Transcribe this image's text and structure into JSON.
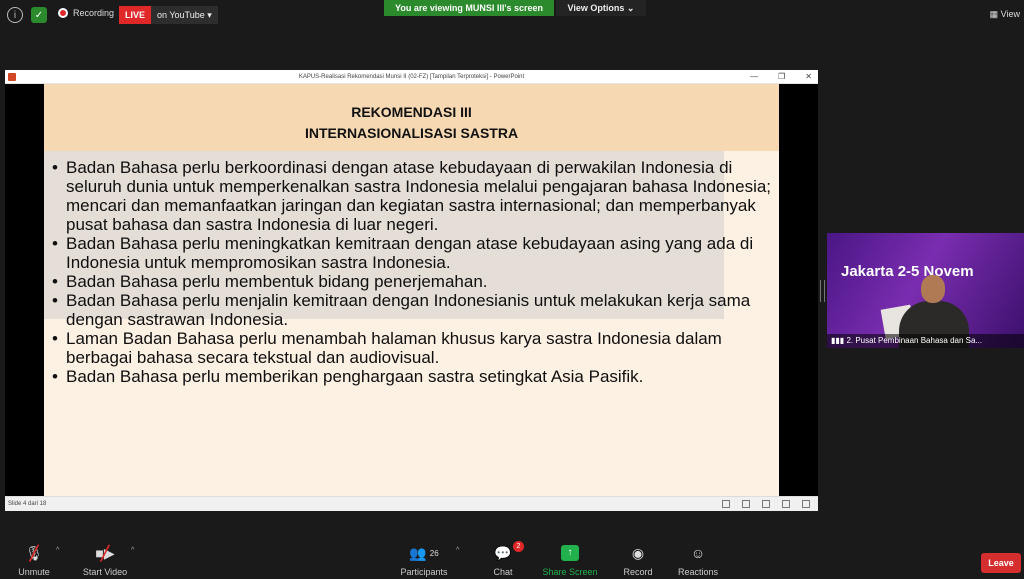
{
  "topbar": {
    "recording_label": "Recording",
    "live_label": "LIVE",
    "youtube_label": "on YouTube ▾",
    "viewing_banner": "You are viewing MUNSI III's screen",
    "view_options": "View Options ⌄",
    "view_right": "View"
  },
  "ppt": {
    "window_title": "KAPUS-Realisasi Rekomendasi Munsi II (02-FZ) [Tampilan Terproteksi] - PowerPoint",
    "slide_title_1": "REKOMENDASI III",
    "slide_title_2": "INTERNASIONALISASI SASTRA",
    "bullets": [
      "Badan Bahasa perlu berkoordinasi dengan atase kebudayaan di perwakilan Indonesia di seluruh dunia untuk memperkenalkan sastra Indonesia melalui pengajaran bahasa Indonesia; mencari dan memanfaatkan jaringan dan kegiatan sastra internasional; dan memperbanyak pusat bahasa dan sastra Indonesia di luar negeri.",
      "Badan Bahasa perlu meningkatkan kemitraan dengan atase kebudayaan asing yang ada di Indonesia untuk mempromosikan sastra Indonesia.",
      "Badan Bahasa perlu membentuk bidang penerjemahan.",
      "Badan Bahasa perlu menjalin kemitraan dengan Indonesianis untuk melakukan kerja sama dengan sastrawan Indonesia.",
      "Laman Badan Bahasa perlu menambah halaman khusus karya sastra Indonesia dalam berbagai bahasa secara tekstual dan audiovisual.",
      "Badan Bahasa perlu memberikan penghargaan sastra setingkat Asia Pasifik."
    ],
    "status_text": "Slide 4 dari 18"
  },
  "video": {
    "overlay_text": "Jakarta  2-5 Novem",
    "participant_name": "2. Pusat Pembinaan Bahasa dan Sa..."
  },
  "bottombar": {
    "unmute": "Unmute",
    "start_video": "Start Video",
    "participants": "Participants",
    "participants_count": "26",
    "chat": "Chat",
    "chat_badge": "2",
    "share_screen": "Share Screen",
    "record": "Record",
    "reactions": "Reactions",
    "leave": "Leave"
  }
}
